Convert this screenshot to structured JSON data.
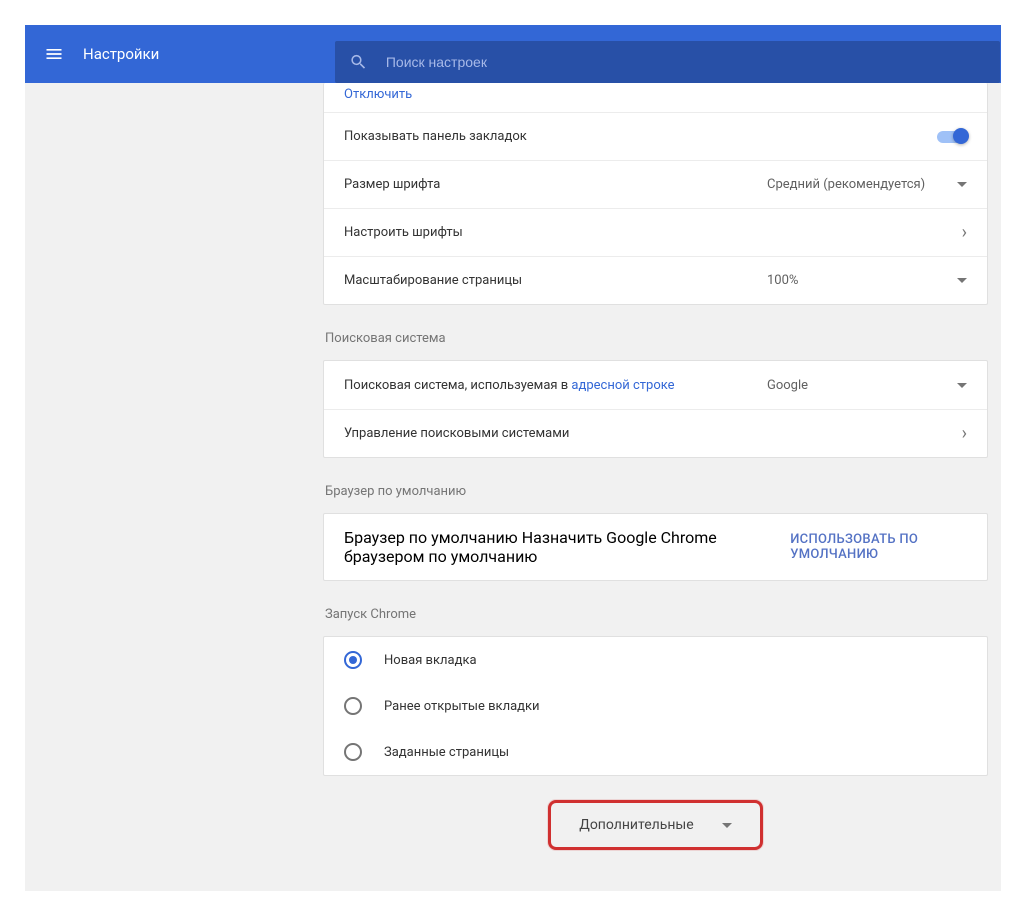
{
  "header": {
    "title": "Настройки",
    "search_placeholder": "Поиск настроек"
  },
  "appearance": {
    "truncated_link": "Отключить",
    "show_bookmarks": "Показывать панель закладок",
    "font_size_label": "Размер шрифта",
    "font_size_value": "Средний (рекомендуется)",
    "customize_fonts": "Настроить шрифты",
    "page_zoom_label": "Масштабирование страницы",
    "page_zoom_value": "100%"
  },
  "search": {
    "section": "Поисковая система",
    "engine_label_prefix": "Поисковая система, используемая в ",
    "engine_label_link": "адресной строке",
    "engine_value": "Google",
    "manage": "Управление поисковыми системами"
  },
  "default_browser": {
    "section": "Браузер по умолчанию",
    "title": "Браузер по умолчанию",
    "subtitle": "Назначить Google Chrome браузером по умолчанию",
    "button": "Использовать по умолчанию"
  },
  "startup": {
    "section": "Запуск Chrome",
    "options": [
      {
        "label": "Новая вкладка",
        "selected": true
      },
      {
        "label": "Ранее открытые вкладки",
        "selected": false
      },
      {
        "label": "Заданные страницы",
        "selected": false
      }
    ]
  },
  "advanced": "Дополнительные"
}
